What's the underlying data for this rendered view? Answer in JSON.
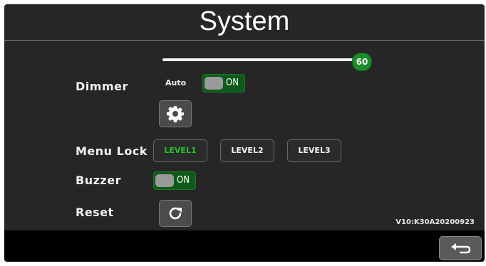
{
  "header": {
    "title": "System"
  },
  "dimmer": {
    "label": "Dimmer",
    "level": 60,
    "level_label": "60",
    "auto_label": "Auto",
    "auto_toggle_text": "ON",
    "settings_icon": "gear-icon"
  },
  "menu_lock": {
    "label": "Menu Lock",
    "levels": [
      "LEVEL1",
      "LEVEL2",
      "LEVEL3"
    ],
    "selected": "LEVEL1",
    "selected_color": "#27c22d"
  },
  "buzzer": {
    "label": "Buzzer",
    "toggle_text": "ON"
  },
  "reset": {
    "label": "Reset",
    "icon": "refresh-icon"
  },
  "version": "V10:K30A20200923",
  "footer": {
    "back_icon": "back-arrow-icon"
  },
  "colors": {
    "accent": "#1c8c2c",
    "background": "#262626",
    "footer": "#000000"
  }
}
